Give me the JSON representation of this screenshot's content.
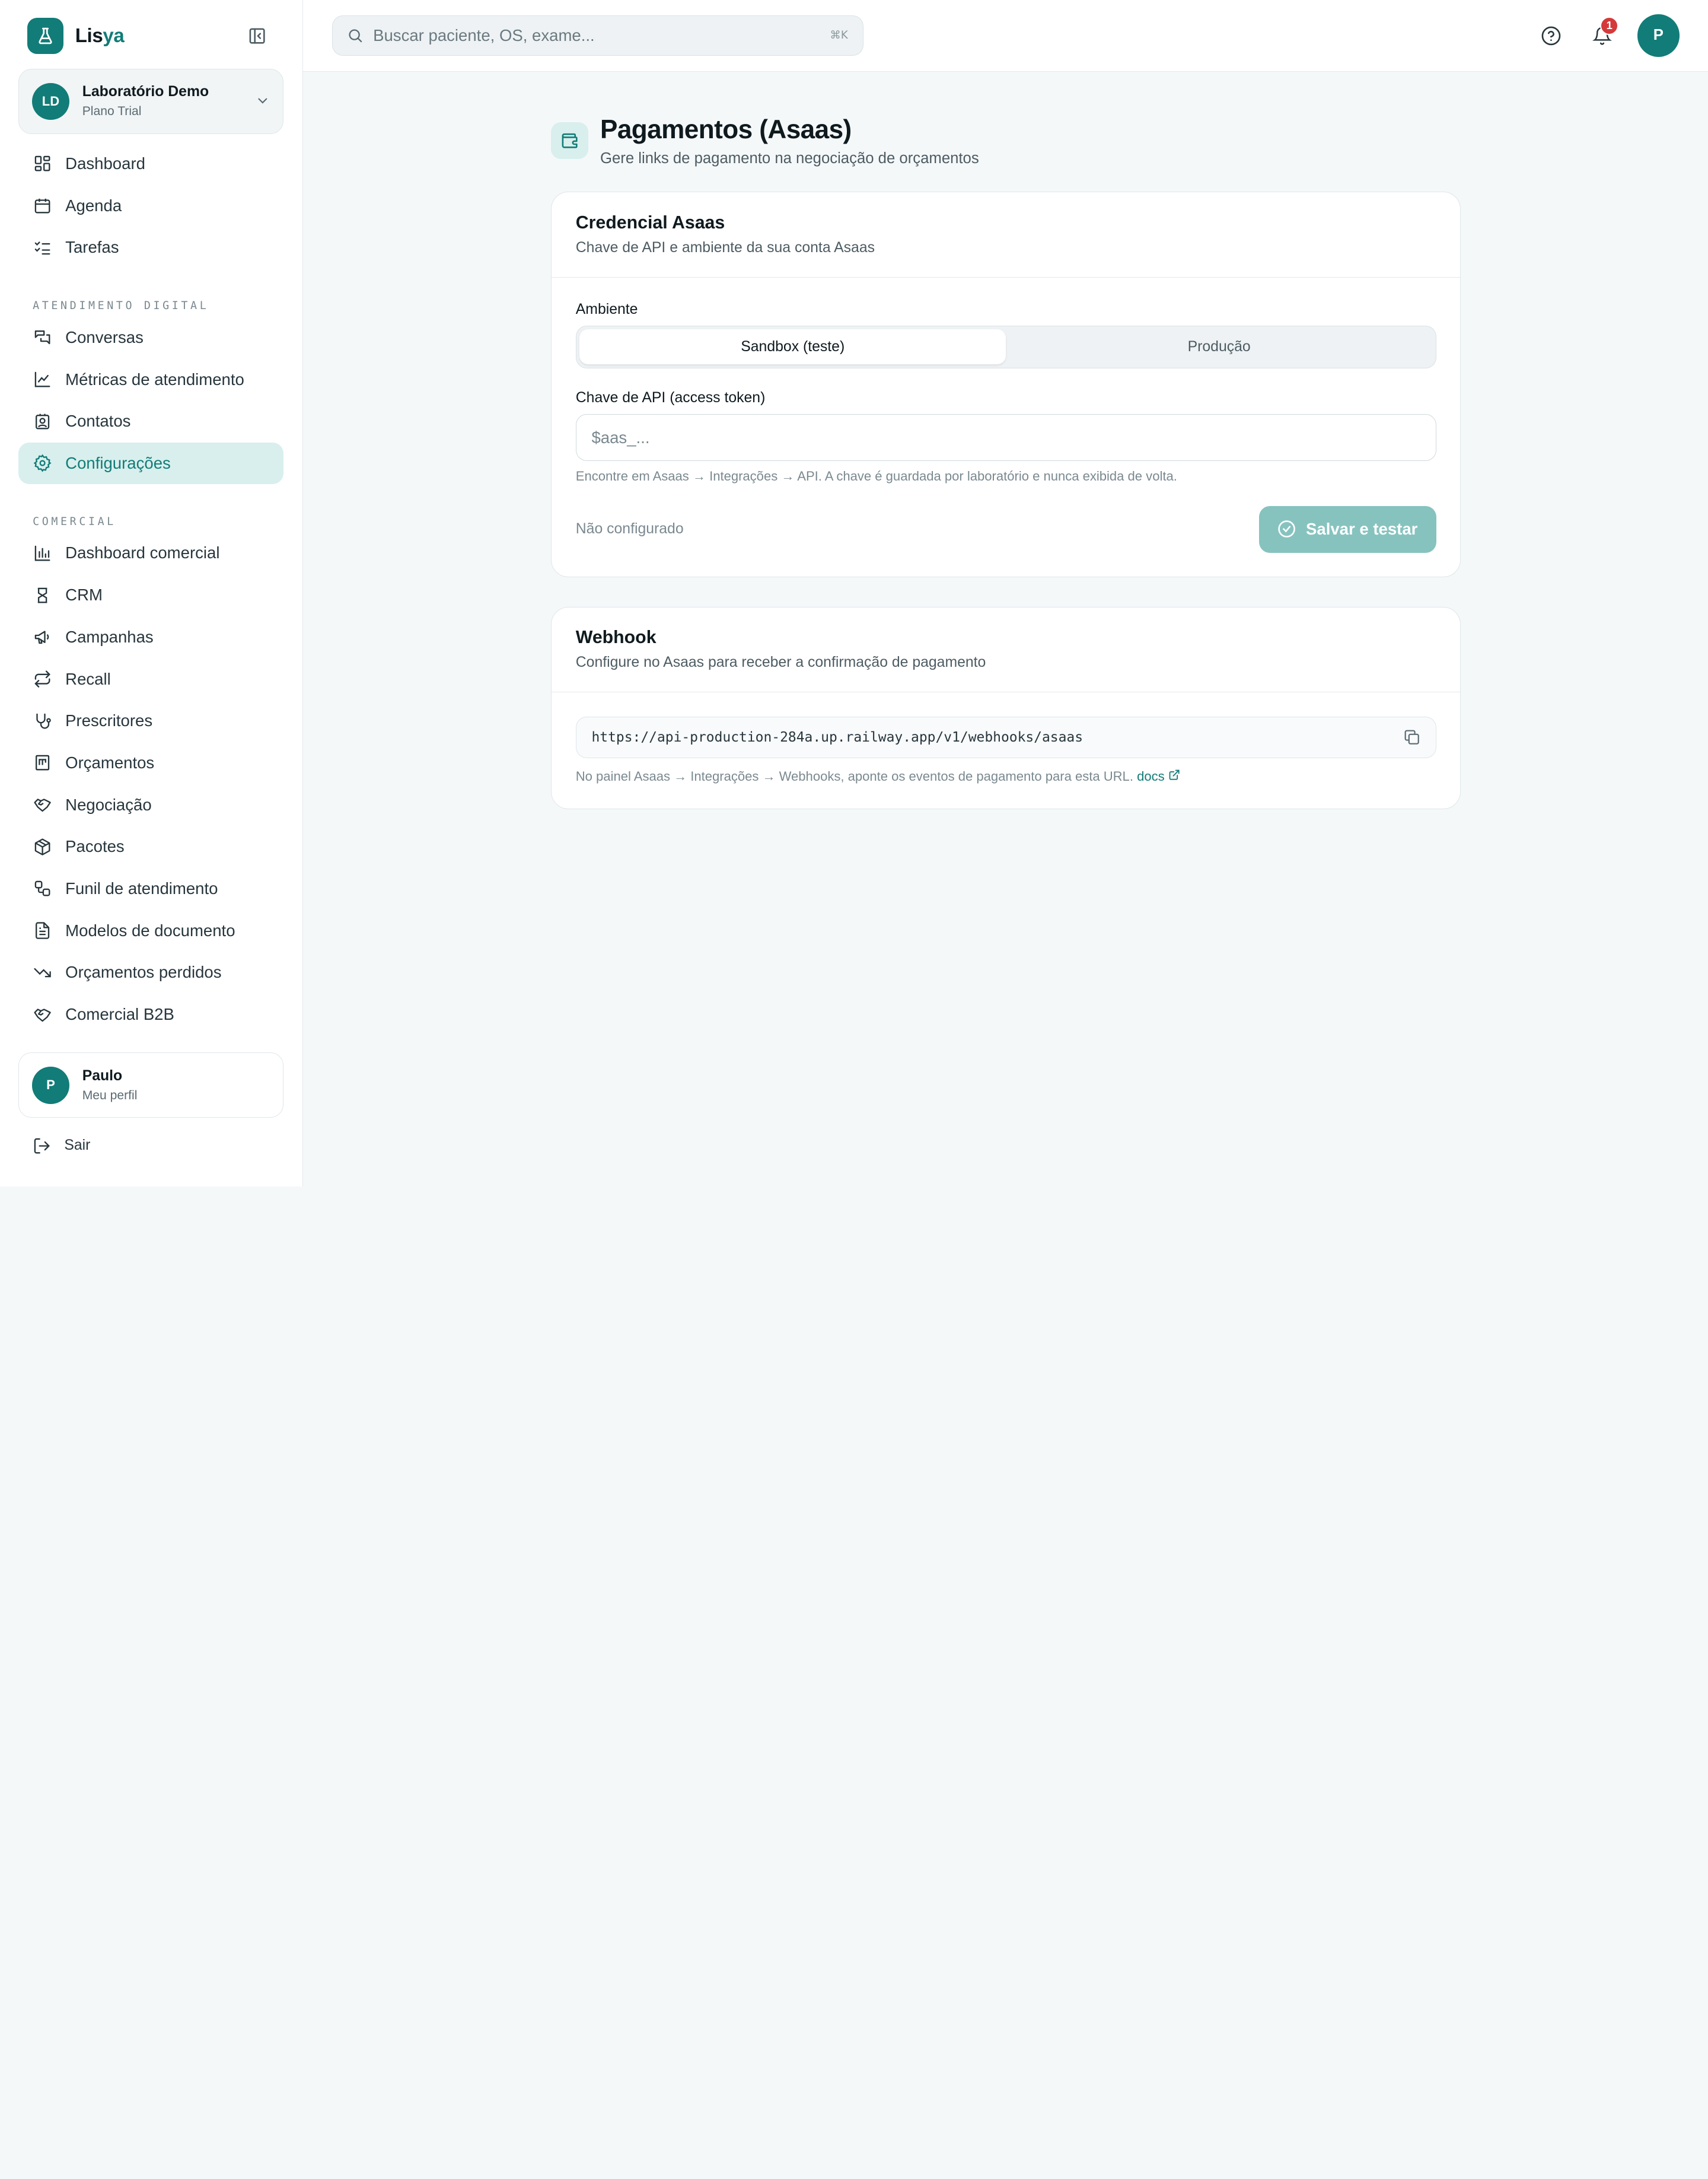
{
  "brand": {
    "name_prefix": "Lis",
    "name_accent": "ya"
  },
  "org": {
    "initials": "LD",
    "name": "Laboratório Demo",
    "plan": "Plano Trial"
  },
  "nav": {
    "top": [
      {
        "label": "Dashboard",
        "icon": "dashboard-icon"
      },
      {
        "label": "Agenda",
        "icon": "calendar-icon"
      },
      {
        "label": "Tarefas",
        "icon": "list-checks-icon"
      }
    ],
    "section1": "ATENDIMENTO DIGITAL",
    "digital": [
      {
        "label": "Conversas",
        "icon": "chat-icon"
      },
      {
        "label": "Métricas de atendimento",
        "icon": "line-chart-icon"
      },
      {
        "label": "Contatos",
        "icon": "contact-icon"
      },
      {
        "label": "Configurações",
        "icon": "gear-icon"
      }
    ],
    "section2": "COMERCIAL",
    "comercial": [
      {
        "label": "Dashboard comercial",
        "icon": "bar-chart-icon"
      },
      {
        "label": "CRM",
        "icon": "crm-icon"
      },
      {
        "label": "Campanhas",
        "icon": "megaphone-icon"
      },
      {
        "label": "Recall",
        "icon": "repeat-icon"
      },
      {
        "label": "Prescritores",
        "icon": "stethoscope-icon"
      },
      {
        "label": "Orçamentos",
        "icon": "receipt-icon"
      },
      {
        "label": "Negociação",
        "icon": "handshake-icon"
      },
      {
        "label": "Pacotes",
        "icon": "package-icon"
      },
      {
        "label": "Funil de atendimento",
        "icon": "workflow-icon"
      },
      {
        "label": "Modelos de documento",
        "icon": "document-icon"
      },
      {
        "label": "Orçamentos perdidos",
        "icon": "trending-down-icon"
      },
      {
        "label": "Comercial B2B",
        "icon": "handshake-icon"
      }
    ]
  },
  "profile": {
    "initial": "P",
    "name": "Paulo",
    "sub": "Meu perfil"
  },
  "logout_label": "Sair",
  "search": {
    "placeholder": "Buscar paciente, OS, exame...",
    "shortcut": "⌘K"
  },
  "notifications": {
    "count": "1"
  },
  "user_initial": "P",
  "page": {
    "title": "Pagamentos (Asaas)",
    "subtitle": "Gere links de pagamento na negociação de orçamentos"
  },
  "credential": {
    "title": "Credencial Asaas",
    "desc": "Chave de API e ambiente da sua conta Asaas",
    "env_label": "Ambiente",
    "env_options": [
      "Sandbox (teste)",
      "Produção"
    ],
    "env_selected": "Sandbox (teste)",
    "key_label": "Chave de API (access token)",
    "key_placeholder": "$aas_...",
    "key_value": "",
    "hint": "Encontre em Asaas → Integrações → API. A chave é guardada por laboratório e nunca exibida de volta.",
    "status": "Não configurado",
    "save_label": "Salvar e testar"
  },
  "webhook": {
    "title": "Webhook",
    "desc": "Configure no Asaas para receber a confirmação de pagamento",
    "url": "https://api-production-284a.up.railway.app/v1/webhooks/asaas",
    "hint": "No painel Asaas → Integrações → Webhooks, aponte os eventos de pagamento para esta URL.",
    "docs_label": "docs"
  },
  "colors": {
    "brand": "#127c78",
    "active_bg": "#d8efed",
    "badge": "#d43a3a",
    "button_disabled": "#86c3bf"
  }
}
